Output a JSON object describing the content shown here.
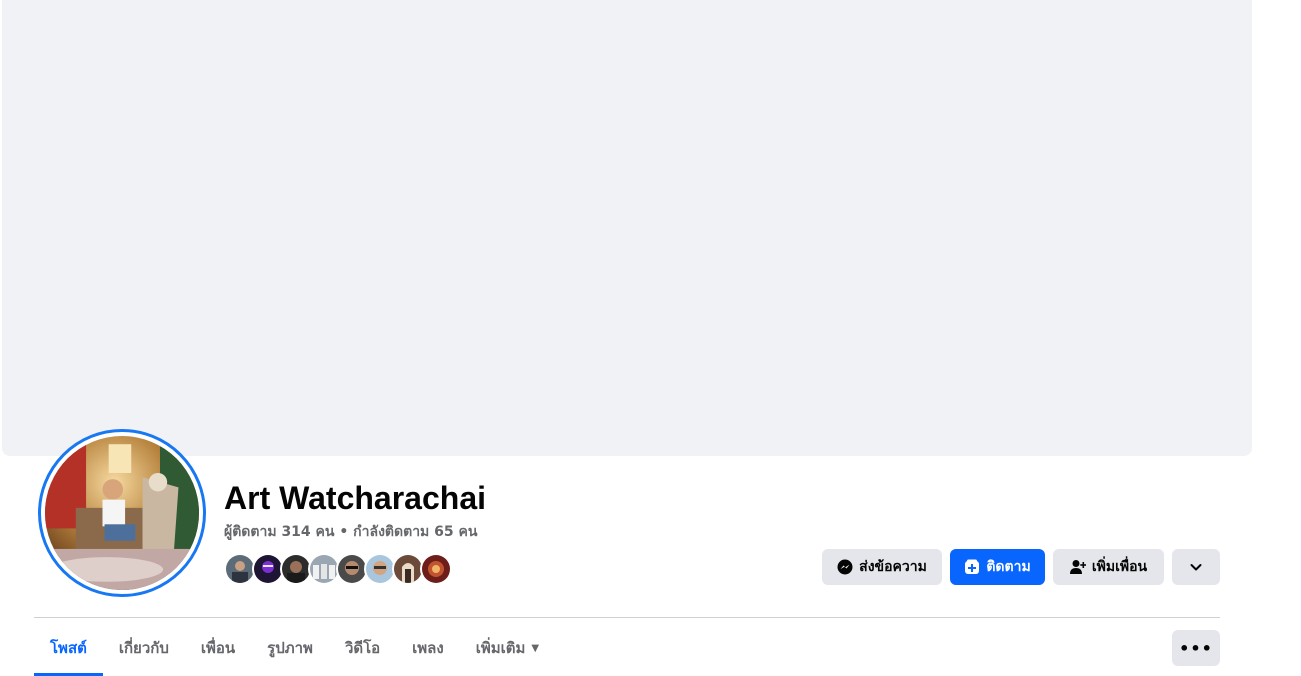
{
  "profile": {
    "name": "Art Watcharachai",
    "stats": "ผู้ติดตาม 314 คน • กำลังติดตาม 65 คน"
  },
  "actions": {
    "message_label": "ส่งข้อความ",
    "follow_label": "ติดตาม",
    "add_friend_label": "เพิ่มเพื่อน"
  },
  "tabs": [
    {
      "label": "โพสต์",
      "active": true
    },
    {
      "label": "เกี่ยวกับ"
    },
    {
      "label": "เพื่อน"
    },
    {
      "label": "รูปภาพ"
    },
    {
      "label": "วิดีโอ"
    },
    {
      "label": "เพลง"
    },
    {
      "label": "เพิ่มเติม"
    }
  ],
  "tabs_more_label": "•••",
  "friend_thumbnails_count": 8,
  "colors": {
    "accent": "#0866ff",
    "avatar_ring": "#1877f2",
    "cover_bg": "#f0f2f5",
    "button_grey": "#e4e6eb",
    "secondary_text": "#65676b"
  },
  "icons": {
    "message": "messenger-icon",
    "follow": "follow-icon",
    "add_friend": "add-friend-icon",
    "dropdown": "chevron-down-icon",
    "tab_more_caret": "caret-down-icon",
    "more": "ellipsis-icon"
  }
}
